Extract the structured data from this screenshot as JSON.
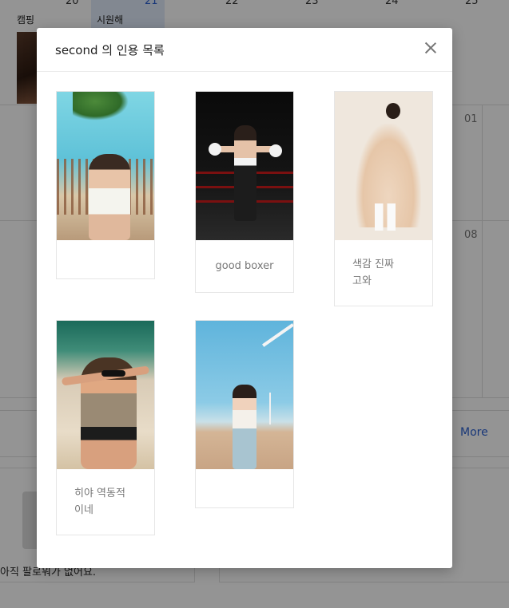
{
  "background": {
    "calendar_days": [
      "20",
      "21",
      "22",
      "23",
      "24",
      "25"
    ],
    "today_day": "21",
    "event_labels": [
      "캠핑",
      "시원해"
    ],
    "cell_days": [
      "01",
      "08"
    ],
    "more_link": "More",
    "empty_message": "아직 팔로워가 없어요."
  },
  "modal": {
    "title": "second 의 인용 목록",
    "close_icon": "close-icon",
    "cards": [
      {
        "image": "photo-woman-sitting-on-beach-fence",
        "caption": ""
      },
      {
        "image": "photo-woman-boxing-ring",
        "caption": "good boxer"
      },
      {
        "image": "photo-woman-beige-tulle-dress",
        "caption": "색감 진짜\n고와"
      },
      {
        "image": "photo-woman-sunglasses-peace-sign",
        "caption": "히야 역동적\n이네"
      },
      {
        "image": "photo-woman-wind-turbine-field",
        "caption": ""
      }
    ]
  },
  "colors": {
    "accent": "#2a5fd0",
    "overlay": "rgba(0,0,0,0.42)",
    "today_column": "#e1ebfa"
  }
}
